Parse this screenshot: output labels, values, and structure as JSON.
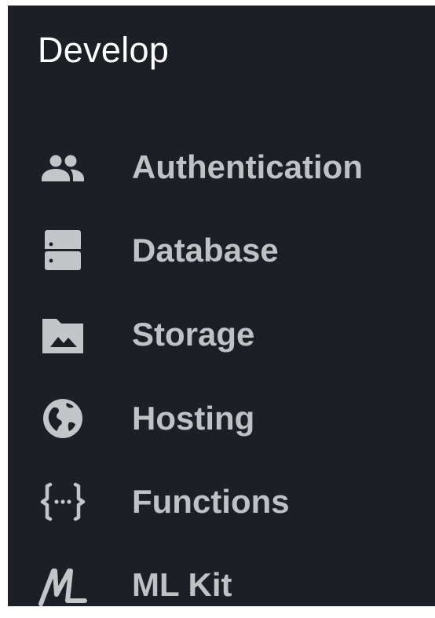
{
  "section": {
    "title": "Develop"
  },
  "nav": {
    "items": [
      {
        "label": "Authentication",
        "icon": "people-icon"
      },
      {
        "label": "Database",
        "icon": "database-icon"
      },
      {
        "label": "Storage",
        "icon": "image-folder-icon"
      },
      {
        "label": "Hosting",
        "icon": "globe-icon"
      },
      {
        "label": "Functions",
        "icon": "functions-icon"
      },
      {
        "label": "ML Kit",
        "icon": "ml-kit-icon"
      }
    ]
  },
  "colors": {
    "panel_background": "#1d1f27",
    "title_text": "#ffffff",
    "item_text": "#c0c1c4",
    "icon": "#c4c5c8"
  }
}
